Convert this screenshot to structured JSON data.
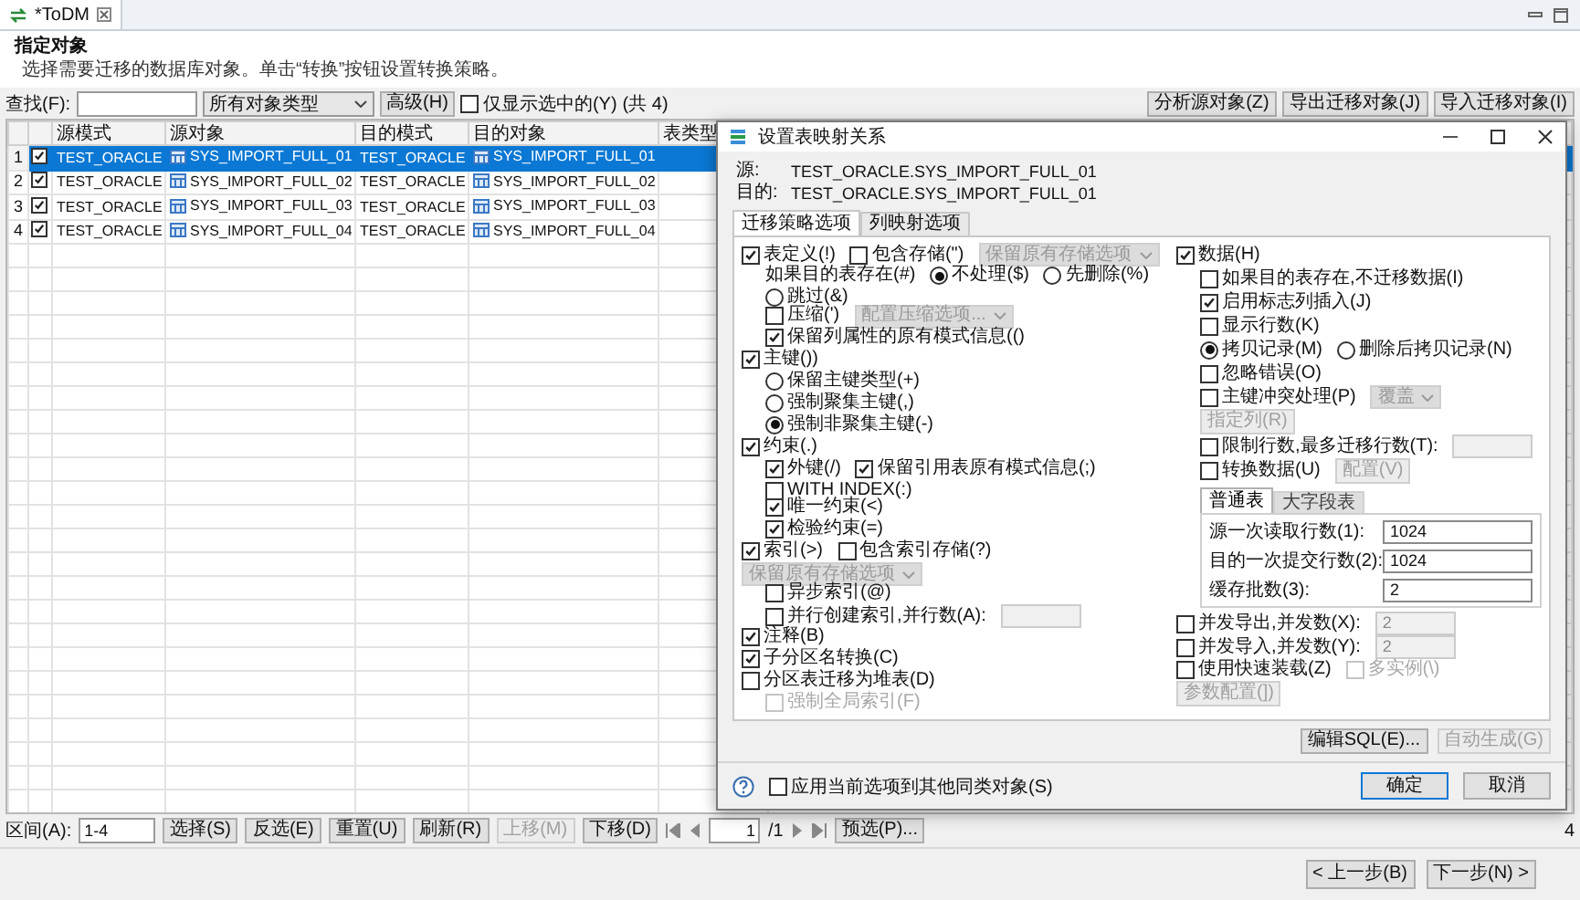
{
  "editor_tab": {
    "title": "*ToDM"
  },
  "page": {
    "title": "指定对象",
    "description": "选择需要迁移的数据库对象。单击“转换”按钮设置转换策略。"
  },
  "toolbar": {
    "search_label": "查找(F):",
    "type_filter": "所有对象类型",
    "advanced_button": "高级(H)",
    "show_selected": {
      "label": "仅显示选中的(Y)",
      "checked": false
    },
    "count": "(共 4)",
    "buttons": [
      "分析源对象(Z)",
      "导出迁移对象(J)",
      "导入迁移对象(I)"
    ]
  },
  "table": {
    "columns": [
      "源模式",
      "源对象",
      "目的模式",
      "目的对象",
      "表类型"
    ],
    "rows": [
      {
        "index": "1",
        "checked": true,
        "selected": true,
        "source_schema": "TEST_ORACLE",
        "source_object": "SYS_IMPORT_FULL_01",
        "target_schema": "TEST_ORACLE",
        "target_object": "SYS_IMPORT_FULL_01"
      },
      {
        "index": "2",
        "checked": true,
        "selected": false,
        "source_schema": "TEST_ORACLE",
        "source_object": "SYS_IMPORT_FULL_02",
        "target_schema": "TEST_ORACLE",
        "target_object": "SYS_IMPORT_FULL_02"
      },
      {
        "index": "3",
        "checked": true,
        "selected": false,
        "source_schema": "TEST_ORACLE",
        "source_object": "SYS_IMPORT_FULL_03",
        "target_schema": "TEST_ORACLE",
        "target_object": "SYS_IMPORT_FULL_03"
      },
      {
        "index": "4",
        "checked": true,
        "selected": false,
        "source_schema": "TEST_ORACLE",
        "source_object": "SYS_IMPORT_FULL_04",
        "target_schema": "TEST_ORACLE",
        "target_object": "SYS_IMPORT_FULL_04"
      }
    ]
  },
  "bottom_toolbar": {
    "range_label": "区间(A):",
    "range_value": "1-4",
    "buttons": [
      {
        "label": "选择(S)",
        "disabled": false
      },
      {
        "label": "反选(E)",
        "disabled": false
      },
      {
        "label": "重置(U)",
        "disabled": false
      },
      {
        "label": "刷新(R)",
        "disabled": false
      },
      {
        "label": "上移(M)",
        "disabled": true
      },
      {
        "label": "下移(D)",
        "disabled": false
      }
    ],
    "page_value": "1",
    "page_total": "/1",
    "preselect_button": "预选(P)...",
    "trailing_text": "4"
  },
  "wizard_buttons": [
    "< 上一步(B)",
    "下一步(N) >"
  ],
  "dialog": {
    "title": "设置表映射关系",
    "source_label": "源:",
    "source": "TEST_ORACLE.SYS_IMPORT_FULL_01",
    "target_label": "目的:",
    "target": "TEST_ORACLE.SYS_IMPORT_FULL_01",
    "tabs": [
      {
        "label": "迁移策略选项",
        "selected": true
      },
      {
        "label": "列映射选项",
        "selected": false
      }
    ],
    "left_options": [
      {
        "items": [
          {
            "kind": "checkbox",
            "label": "表定义(!)",
            "checked": true,
            "disabled": false
          },
          {
            "kind": "checkbox",
            "label": "包含存储(\")",
            "checked": false,
            "disabled": false
          },
          {
            "kind": "select",
            "value": "保留原有存储选项",
            "disabled": true
          }
        ],
        "children": [
          {
            "items": [
              {
                "kind": "label",
                "text": "如果目的表存在(#)"
              },
              {
                "kind": "radio",
                "label": "不处理($)",
                "selected": true
              },
              {
                "kind": "radio",
                "label": "先删除(%)",
                "selected": false
              },
              {
                "kind": "radio",
                "label": "跳过(&)",
                "selected": false
              }
            ]
          },
          {
            "items": [
              {
                "kind": "checkbox",
                "label": "压缩(')",
                "checked": false,
                "disabled": false
              },
              {
                "kind": "select",
                "value": "配置压缩选项...",
                "disabled": true
              }
            ]
          },
          {
            "items": [
              {
                "kind": "checkbox",
                "label": "保留列属性的原有模式信息(()",
                "checked": true,
                "disabled": false
              }
            ]
          }
        ]
      },
      {
        "items": [
          {
            "kind": "checkbox",
            "label": "主键())",
            "checked": true,
            "disabled": false
          }
        ],
        "children": [
          {
            "items": [
              {
                "kind": "radio",
                "label": "保留主键类型(+)",
                "selected": false
              }
            ]
          },
          {
            "items": [
              {
                "kind": "radio",
                "label": "强制聚集主键(,)",
                "selected": false
              }
            ]
          },
          {
            "items": [
              {
                "kind": "radio",
                "label": "强制非聚集主键(-)",
                "selected": true
              }
            ]
          }
        ]
      },
      {
        "items": [
          {
            "kind": "checkbox",
            "label": "约束(.)",
            "checked": true,
            "disabled": false
          }
        ],
        "children": [
          {
            "items": [
              {
                "kind": "checkbox",
                "label": "外键(/)",
                "checked": true,
                "disabled": false
              },
              {
                "kind": "checkbox",
                "label": "保留引用表原有模式信息(;)",
                "checked": true,
                "disabled": false
              },
              {
                "kind": "checkbox",
                "label": "WITH INDEX(:)",
                "checked": false,
                "disabled": false
              }
            ]
          },
          {
            "items": [
              {
                "kind": "checkbox",
                "label": "唯一约束(<)",
                "checked": true,
                "disabled": false
              }
            ]
          },
          {
            "items": [
              {
                "kind": "checkbox",
                "label": "检验约束(=)",
                "checked": true,
                "disabled": false
              }
            ]
          }
        ]
      },
      {
        "items": [
          {
            "kind": "checkbox",
            "label": "索引(>)",
            "checked": true,
            "disabled": false
          },
          {
            "kind": "checkbox",
            "label": "包含索引存储(?)",
            "checked": false,
            "disabled": false
          },
          {
            "kind": "select",
            "value": "保留原有存储选项",
            "disabled": true
          }
        ],
        "children": [
          {
            "items": [
              {
                "kind": "checkbox",
                "label": "异步索引(@)",
                "checked": false,
                "disabled": false
              }
            ]
          },
          {
            "items": [
              {
                "kind": "checkbox",
                "label": "并行创建索引,并行数(A):",
                "checked": false,
                "disabled": false
              },
              {
                "kind": "input",
                "disabled": true
              }
            ]
          }
        ]
      },
      {
        "items": [
          {
            "kind": "checkbox",
            "label": "注释(B)",
            "checked": true,
            "disabled": false
          }
        ]
      },
      {
        "items": [
          {
            "kind": "checkbox",
            "label": "子分区名转换(C)",
            "checked": true,
            "disabled": false
          }
        ]
      },
      {
        "items": [
          {
            "kind": "checkbox",
            "label": "分区表迁移为堆表(D)",
            "checked": false,
            "disabled": false
          }
        ],
        "children": [
          {
            "items": [
              {
                "kind": "checkbox",
                "label": "强制全局索引(F)",
                "checked": false,
                "disabled": true
              }
            ]
          }
        ]
      }
    ],
    "right_options": [
      {
        "items": [
          {
            "kind": "checkbox",
            "label": "数据(H)",
            "checked": true,
            "disabled": false
          }
        ],
        "children": [
          {
            "items": [
              {
                "kind": "checkbox",
                "label": "如果目的表存在,不迁移数据(I)",
                "checked": false,
                "disabled": false
              }
            ]
          },
          {
            "items": [
              {
                "kind": "checkbox",
                "label": "启用标志列插入(J)",
                "checked": true,
                "disabled": false
              }
            ]
          },
          {
            "items": [
              {
                "kind": "checkbox",
                "label": "显示行数(K)",
                "checked": false,
                "disabled": false
              }
            ]
          },
          {
            "items": [
              {
                "kind": "radio",
                "label": "拷贝记录(M)",
                "selected": true
              },
              {
                "kind": "radio",
                "label": "删除后拷贝记录(N)",
                "selected": false
              }
            ]
          },
          {
            "items": [
              {
                "kind": "checkbox",
                "label": "忽略错误(O)",
                "checked": false,
                "disabled": false
              }
            ]
          },
          {
            "items": [
              {
                "kind": "checkbox",
                "label": "主键冲突处理(P)",
                "checked": false,
                "disabled": false
              },
              {
                "kind": "select",
                "value": "覆盖",
                "disabled": true
              },
              {
                "kind": "button",
                "label": "指定列(R)",
                "disabled": true
              }
            ]
          },
          {
            "items": [
              {
                "kind": "checkbox",
                "label": "限制行数,最多迁移行数(T):",
                "checked": false,
                "disabled": false
              },
              {
                "kind": "input",
                "disabled": true
              }
            ]
          },
          {
            "items": [
              {
                "kind": "checkbox",
                "label": "转换数据(U)",
                "checked": false,
                "disabled": false
              },
              {
                "kind": "button",
                "label": "配置(V)",
                "disabled": true
              }
            ]
          }
        ],
        "subpanel": {
          "tabs": [
            {
              "label": "普通表",
              "selected": true
            },
            {
              "label": "大字段表",
              "selected": false
            }
          ],
          "fields": [
            {
              "label": "源一次读取行数(1):",
              "value": "1024"
            },
            {
              "label": "目的一次提交行数(2):",
              "value": "1024"
            },
            {
              "label": "缓存批数(3):",
              "value": "2"
            }
          ]
        }
      },
      {
        "items": [
          {
            "kind": "checkbox",
            "label": "并发导出,并发数(X):",
            "checked": false,
            "disabled": false
          },
          {
            "kind": "input",
            "value": "2",
            "disabled": true
          }
        ]
      },
      {
        "items": [
          {
            "kind": "checkbox",
            "label": "并发导入,并发数(Y):",
            "checked": false,
            "disabled": false
          },
          {
            "kind": "input",
            "value": "2",
            "disabled": true
          }
        ]
      },
      {
        "items": [
          {
            "kind": "checkbox",
            "label": "使用快速装载(Z)",
            "checked": false,
            "disabled": false
          },
          {
            "kind": "checkbox",
            "label": "多实例(\\)",
            "checked": false,
            "disabled": true
          },
          {
            "kind": "button",
            "label": "参数配置(])",
            "disabled": true
          }
        ]
      }
    ],
    "action_buttons": [
      {
        "label": "编辑SQL(E)...",
        "disabled": false
      },
      {
        "label": "自动生成(G)",
        "disabled": true
      }
    ],
    "apply_all": {
      "label": "应用当前选项到其他同类对象(S)",
      "checked": false
    },
    "footer_buttons": [
      {
        "label": "确定",
        "default": true
      },
      {
        "label": "取消",
        "default": false
      }
    ]
  }
}
